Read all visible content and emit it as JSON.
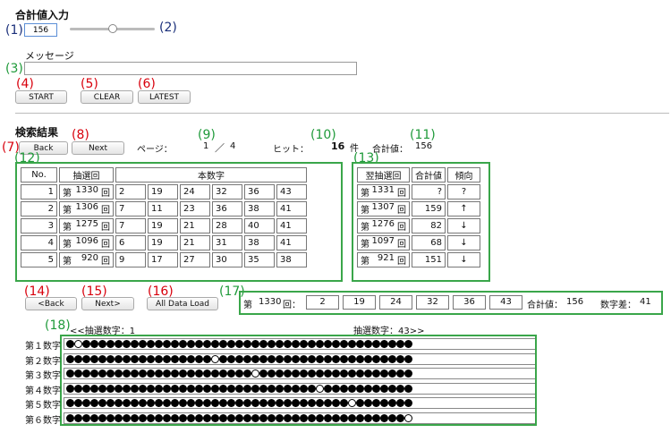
{
  "header": {
    "title": "合計値入力"
  },
  "ann": {
    "n1": "(1)",
    "n2": "(2)",
    "n3": "(3)",
    "n4": "(4)",
    "n5": "(5)",
    "n6": "(6)",
    "n7": "(7)",
    "n8": "(8)",
    "n9": "(9)",
    "n10": "(10)",
    "n11": "(11)",
    "n12": "(12)",
    "n13": "(13)",
    "n14": "(14)",
    "n15": "(15)",
    "n16": "(16)",
    "n17": "(17)",
    "n18": "(18)"
  },
  "input": {
    "sum_value": "156",
    "slider_level": 0.5
  },
  "message": {
    "label": "メッセージ",
    "value": ""
  },
  "buttons": {
    "start": "START",
    "clear": "CLEAR",
    "latest": "LATEST",
    "back": "Back",
    "next": "Next",
    "back2": "<Back",
    "next2": "Next>",
    "all_load": "All Data Load"
  },
  "results": {
    "title": "検索結果",
    "page_label": "ページ：",
    "page_current": "1",
    "page_sep": "／",
    "page_total": "4",
    "hit_label": "ヒット：",
    "hit_count": "16",
    "hit_unit": "件",
    "sum_label": "合計値：",
    "sum_value": "156"
  },
  "table_left": {
    "headers": {
      "no": "No.",
      "draw": "抽選回",
      "numbers": "本数字"
    },
    "prefix": "第",
    "suffix": "回",
    "rows": [
      {
        "no": "1",
        "draw": "1330",
        "nums": [
          "2",
          "19",
          "24",
          "32",
          "36",
          "43"
        ]
      },
      {
        "no": "2",
        "draw": "1306",
        "nums": [
          "7",
          "11",
          "23",
          "36",
          "38",
          "41"
        ]
      },
      {
        "no": "3",
        "draw": "1275",
        "nums": [
          "7",
          "19",
          "21",
          "28",
          "40",
          "41"
        ]
      },
      {
        "no": "4",
        "draw": "1096",
        "nums": [
          "6",
          "19",
          "21",
          "31",
          "38",
          "41"
        ]
      },
      {
        "no": "5",
        "draw": "920",
        "nums": [
          "9",
          "17",
          "27",
          "30",
          "35",
          "38"
        ]
      }
    ]
  },
  "table_right": {
    "headers": {
      "next_draw": "翌抽選回",
      "sum": "合計値",
      "trend": "傾向"
    },
    "prefix": "第",
    "suffix": "回",
    "rows": [
      {
        "draw": "1331",
        "sum": "?",
        "trend": "?"
      },
      {
        "draw": "1307",
        "sum": "159",
        "trend": "↑"
      },
      {
        "draw": "1276",
        "sum": "82",
        "trend": "↓"
      },
      {
        "draw": "1097",
        "sum": "68",
        "trend": "↓"
      },
      {
        "draw": "921",
        "sum": "151",
        "trend": "↓"
      }
    ]
  },
  "detail": {
    "prefix": "第",
    "draw": "1330",
    "suffix": "回：",
    "nums": [
      "2",
      "19",
      "24",
      "32",
      "36",
      "43"
    ],
    "sum_label": "合計値：",
    "sum_value": "156",
    "diff_label": "数字差：",
    "diff_value": "41"
  },
  "dots": {
    "left_label": "<<抽選数字：1",
    "right_label": "抽選数字：43>>",
    "total": 43,
    "rows": [
      {
        "label": "第１数字",
        "selected": 2
      },
      {
        "label": "第２数字",
        "selected": 19
      },
      {
        "label": "第３数字",
        "selected": 24
      },
      {
        "label": "第４数字",
        "selected": 32
      },
      {
        "label": "第５数字",
        "selected": 36
      },
      {
        "label": "第６数字",
        "selected": 43
      }
    ]
  }
}
